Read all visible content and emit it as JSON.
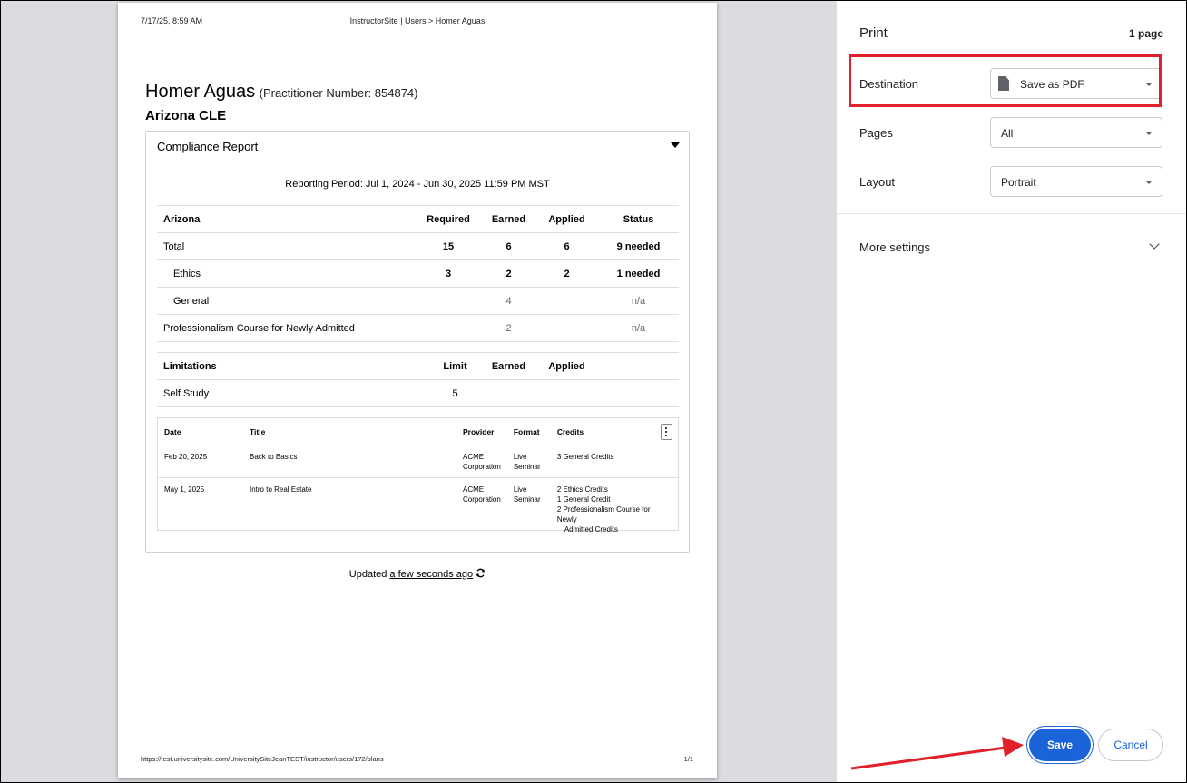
{
  "preview": {
    "header_date": "7/17/25, 8:59 AM",
    "header_title": "InstructorSite | Users > Homer Aguas",
    "name": "Homer Aguas",
    "practitioner": "(Practitioner Number: 854874)",
    "subtitle": "Arizona CLE",
    "card_title": "Compliance Report",
    "period": "Reporting Period: Jul 1, 2024 - Jun 30, 2025 11:59 PM MST",
    "req_table": {
      "headers": [
        "Arizona",
        "Required",
        "Earned",
        "Applied",
        "Status"
      ],
      "rows": [
        {
          "label": "Total",
          "required": "15",
          "earned": "6",
          "applied": "6",
          "status": "9 needed"
        },
        {
          "label": "Ethics",
          "required": "3",
          "earned": "2",
          "applied": "2",
          "status": "1 needed"
        },
        {
          "label": "General",
          "required": "",
          "earned": "4",
          "applied": "",
          "status": "n/a"
        },
        {
          "label": "Professionalism Course for Newly Admitted",
          "required": "",
          "earned": "2",
          "applied": "",
          "status": "n/a"
        }
      ]
    },
    "lim_table": {
      "headers": [
        "Limitations",
        "Limit",
        "Earned",
        "Applied"
      ],
      "rows": [
        {
          "label": "Self Study",
          "limit": "5",
          "earned": "",
          "applied": ""
        }
      ]
    },
    "detail_table": {
      "headers": [
        "Date",
        "Title",
        "Provider",
        "Format",
        "Credits"
      ],
      "rows": [
        {
          "date": "Feb 20, 2025",
          "title": "Back to Basics",
          "provider_1": "ACME",
          "provider_2": "Corporation",
          "format_1": "Live",
          "format_2": "Seminar",
          "credits": [
            "3 General Credits"
          ]
        },
        {
          "date": "May 1, 2025",
          "title": "Intro to Real Estate",
          "provider_1": "ACME",
          "provider_2": "Corporation",
          "format_1": "Live",
          "format_2": "Seminar",
          "credits": [
            "2 Ethics Credits",
            "1 General Credit",
            "2 Professionalism Course for Newly",
            "Admitted Credits"
          ]
        }
      ]
    },
    "updated_prefix": "Updated",
    "updated_link": "a few seconds ago",
    "footer_url": "https://test.universitysite.com/UniversitySiteJeanTEST/instructor/users/172/plans",
    "footer_page": "1/1"
  },
  "panel": {
    "title": "Print",
    "page_count": "1 page",
    "destination_label": "Destination",
    "destination_value": "Save as PDF",
    "pages_label": "Pages",
    "pages_value": "All",
    "layout_label": "Layout",
    "layout_value": "Portrait",
    "more_settings": "More settings",
    "save_label": "Save",
    "cancel_label": "Cancel"
  },
  "colors": {
    "highlight": "#e0202a",
    "accent": "#1a63d8",
    "preview_bg": "#dadce0"
  },
  "icons": [
    "document-icon",
    "dropdown-arrow-icon",
    "chevron-down-icon",
    "refresh-icon",
    "kebab-menu-icon",
    "annotation-arrow"
  ]
}
